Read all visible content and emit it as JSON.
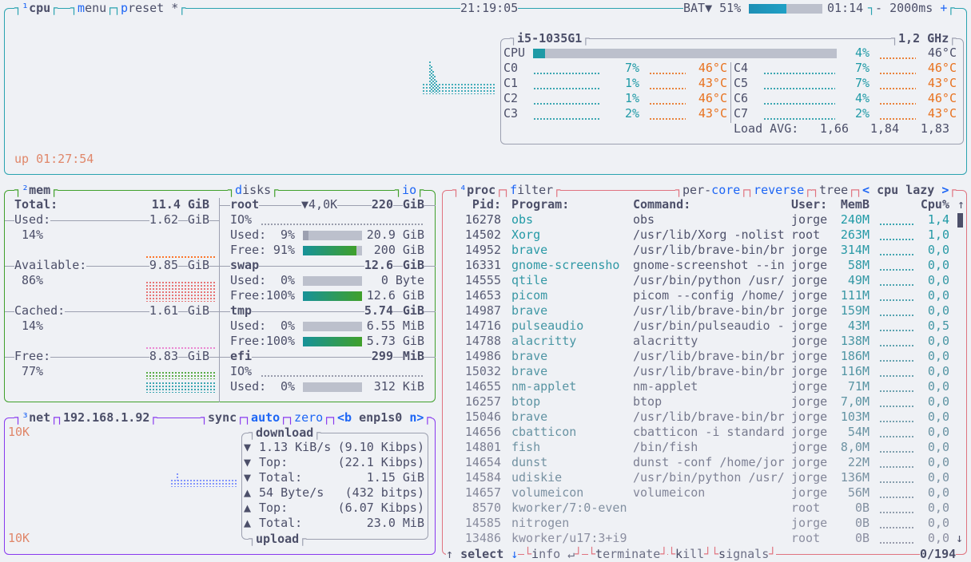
{
  "colors": {
    "background": "#eff1f5",
    "text": "#4c4f69",
    "cpu_box": "#2aa3b0",
    "mem_box": "#40a02b",
    "net_box": "#8839ef",
    "proc_box": "#e0737f",
    "hotkey": "#1e66f5",
    "value": "#1f9aa6",
    "temperature": "#e8721f",
    "uptime": "#e0876a"
  },
  "topbar": {
    "cpu_num": "¹",
    "cpu_label": "cpu",
    "menu_key": "m",
    "menu_rest": "enu",
    "preset_key": "p",
    "preset_rest": "reset *",
    "clock": "21:19:05",
    "battery_label": "BAT▼ 51%",
    "battery_percent": 51,
    "battery_time": "01:14",
    "interval_minus": "-",
    "interval": "2000ms",
    "interval_plus": "+"
  },
  "cpu": {
    "model": "i5-1035G1",
    "freq": "1,2 GHz",
    "total": {
      "label": "CPU",
      "percent": 4,
      "pct_text": "4%",
      "temp": "46°C"
    },
    "cores": [
      {
        "label": "C0",
        "pct": "7%",
        "temp": "46°C"
      },
      {
        "label": "C1",
        "pct": "1%",
        "temp": "43°C"
      },
      {
        "label": "C2",
        "pct": "1%",
        "temp": "46°C"
      },
      {
        "label": "C3",
        "pct": "2%",
        "temp": "43°C"
      },
      {
        "label": "C4",
        "pct": "7%",
        "temp": "46°C"
      },
      {
        "label": "C5",
        "pct": "7%",
        "temp": "43°C"
      },
      {
        "label": "C6",
        "pct": "4%",
        "temp": "46°C"
      },
      {
        "label": "C7",
        "pct": "2%",
        "temp": "43°C"
      }
    ],
    "load_label": "Load AVG:",
    "load": [
      "1,66",
      "1,84",
      "1,83"
    ],
    "uptime": "up 01:27:54"
  },
  "mem": {
    "num": "²",
    "title": "mem",
    "total": {
      "label": "Total:",
      "value": "11.4",
      "unit": "GiB"
    },
    "items": [
      {
        "label": "Used:",
        "value": "1.62",
        "unit": "GiB",
        "pct": "14%",
        "color": "#fe640b"
      },
      {
        "label": "Available:",
        "value": "9.85",
        "unit": "GiB",
        "pct": "86%",
        "color": "#e66060"
      },
      {
        "label": "Cached:",
        "value": "1.61",
        "unit": "GiB",
        "pct": "14%",
        "color": "#ea76cb"
      },
      {
        "label": "Free:",
        "value": "8.83",
        "unit": "GiB",
        "pct": "77%",
        "color": "#40a02b"
      }
    ]
  },
  "disks": {
    "title_key": "d",
    "title_rest": "isks",
    "io_key": "i",
    "io_rest": "o",
    "rows": [
      {
        "type": "header",
        "name": "root",
        "io": "▼4,0K",
        "value": "220",
        "unit": "GiB"
      },
      {
        "type": "io",
        "label": "IO%"
      },
      {
        "type": "bar",
        "label": "Used:",
        "pct": "9%",
        "percent": 9,
        "value": "20.9 GiB",
        "kind": "used"
      },
      {
        "type": "bar",
        "label": "Free:",
        "pct": "91%",
        "percent": 91,
        "value": "200 GiB",
        "kind": "free"
      },
      {
        "type": "header",
        "name": "swap",
        "io": "",
        "value": "12.6",
        "unit": "GiB"
      },
      {
        "type": "bar",
        "label": "Used:",
        "pct": "0%",
        "percent": 0,
        "value": "0 Byte",
        "kind": "used"
      },
      {
        "type": "bar",
        "label": "Free:",
        "pct": "100%",
        "percent": 100,
        "value": "12.6 GiB",
        "kind": "free"
      },
      {
        "type": "header",
        "name": "tmp",
        "io": "",
        "value": "5.74",
        "unit": "GiB"
      },
      {
        "type": "bar",
        "label": "Used:",
        "pct": "0%",
        "percent": 0,
        "value": "6.55 MiB",
        "kind": "used"
      },
      {
        "type": "bar",
        "label": "Free:",
        "pct": "100%",
        "percent": 100,
        "value": "5.73 GiB",
        "kind": "free"
      },
      {
        "type": "header",
        "name": "efi",
        "io": "",
        "value": "299",
        "unit": "MiB"
      },
      {
        "type": "io",
        "label": "IO%"
      },
      {
        "type": "bar",
        "label": "Used:",
        "pct": "0%",
        "percent": 0,
        "value": "312 KiB",
        "kind": "used"
      }
    ]
  },
  "net": {
    "num": "³",
    "title": "net",
    "ip": "192.168.1.92",
    "sync": "sync",
    "auto_key": "a",
    "auto_rest": "uto",
    "zero_key": "z",
    "zero_rest": "ero",
    "iface_prev": "<b",
    "iface": "enp1s0",
    "iface_next": "n>",
    "scale_top": "10K",
    "scale_bottom": "10K",
    "download_title": "download",
    "upload_title": "upload",
    "stats": [
      {
        "arrow": "▼",
        "label": "1.13 KiB/s",
        "value": "(9.10 Kibps)"
      },
      {
        "arrow": "▼",
        "label": "Top:",
        "value": "(22.1 Kibps)"
      },
      {
        "arrow": "▼",
        "label": "Total:",
        "value": "1.15 GiB"
      },
      {
        "arrow": "▲",
        "label": "54 Byte/s",
        "value": "(432 bitps)"
      },
      {
        "arrow": "▲",
        "label": "Top:",
        "value": "(6.07 Kibps)"
      },
      {
        "arrow": "▲",
        "label": "Total:",
        "value": "23.0 MiB"
      }
    ]
  },
  "proc": {
    "num": "⁴",
    "title": "proc",
    "filter_key": "f",
    "filter_rest": "ilter",
    "percore_pre": "per-",
    "percore_key": "c",
    "percore_rest": "ore",
    "reverse_key": "r",
    "reverse_rest": "everse",
    "tree": "tree",
    "sort_prev": "<",
    "sort": "cpu lazy",
    "sort_next": ">",
    "headers": {
      "pid": "Pid:",
      "program": "Program:",
      "command": "Command:",
      "user": "User:",
      "mem": "MemB",
      "cpu": "Cpu%",
      "scroll_up": "↑"
    },
    "scroll_down": "↓",
    "rows": [
      [
        "16278",
        "obs",
        "obs",
        "jorge",
        "240M",
        "1,4"
      ],
      [
        "14502",
        "Xorg",
        "/usr/lib/Xorg -nolist",
        "root",
        "263M",
        "1,0"
      ],
      [
        "14952",
        "brave",
        "/usr/lib/brave-bin/br",
        "jorge",
        "314M",
        "0,0"
      ],
      [
        "16331",
        "gnome-screensho",
        "gnome-screenshot --in",
        "jorge",
        "58M",
        "0,0"
      ],
      [
        "14555",
        "qtile",
        "/usr/bin/python /usr/",
        "jorge",
        "49M",
        "0,0"
      ],
      [
        "14653",
        "picom",
        "picom --config /home/",
        "jorge",
        "111M",
        "0,0"
      ],
      [
        "14987",
        "brave",
        "/usr/lib/brave-bin/br",
        "jorge",
        "159M",
        "0,0"
      ],
      [
        "14716",
        "pulseaudio",
        "/usr/bin/pulseaudio -",
        "jorge",
        "43M",
        "0,5"
      ],
      [
        "14788",
        "alacritty",
        "alacritty",
        "jorge",
        "138M",
        "0,0"
      ],
      [
        "14986",
        "brave",
        "/usr/lib/brave-bin/br",
        "jorge",
        "186M",
        "0,0"
      ],
      [
        "15032",
        "brave",
        "/usr/lib/brave-bin/br",
        "jorge",
        "116M",
        "0,0"
      ],
      [
        "14655",
        "nm-applet",
        "nm-applet",
        "jorge",
        "71M",
        "0,0"
      ],
      [
        "16257",
        "btop",
        "btop",
        "jorge",
        "7,0M",
        "0,0"
      ],
      [
        "15046",
        "brave",
        "/usr/lib/brave-bin/br",
        "jorge",
        "103M",
        "0,0"
      ],
      [
        "14656",
        "cbatticon",
        "cbatticon -i standard",
        "jorge",
        "54M",
        "0,0"
      ],
      [
        "14801",
        "fish",
        "/bin/fish",
        "jorge",
        "8,0M",
        "0,0"
      ],
      [
        "14654",
        "dunst",
        "dunst -conf /home/jor",
        "jorge",
        "22M",
        "0,0"
      ],
      [
        "14584",
        "udiskie",
        "/usr/bin/python /usr/",
        "jorge",
        "136M",
        "0,0"
      ],
      [
        "14657",
        "volumeicon",
        "volumeicon",
        "jorge",
        "56M",
        "0,0"
      ],
      [
        "8570",
        "kworker/7:0-even",
        "",
        "root",
        "0B",
        "0,0"
      ],
      [
        "14585",
        "nitrogen",
        "",
        "jorge",
        "0B",
        "0,0"
      ],
      [
        "13486",
        "kworker/u17:3+i9",
        "",
        "root",
        "0B",
        "0,0"
      ]
    ],
    "footer": {
      "up": "↑",
      "select": "select",
      "down": "↓",
      "info_key": "i",
      "info_rest": "nfo ↵",
      "terminate_key": "t",
      "terminate_rest": "erminate",
      "kill_key": "k",
      "kill_rest": "ill",
      "signals_key": "s",
      "signals_rest": "ignals",
      "count": "0/194"
    }
  }
}
